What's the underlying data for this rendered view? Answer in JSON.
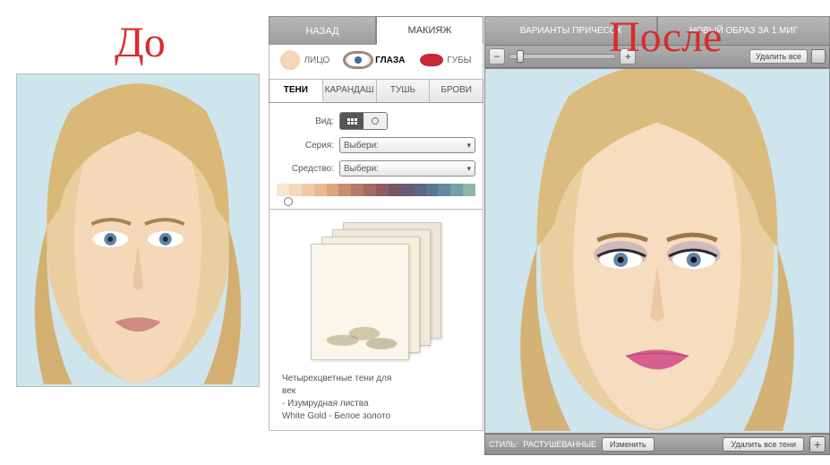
{
  "labels": {
    "before": "До",
    "after": "После"
  },
  "top_tabs": {
    "back": "НАЗАД",
    "makeup": "МАКИЯЖ",
    "hairstyles": "ВАРИАНТЫ ПРИЧЕСОК",
    "new_look": "НОВЫЙ ОБРАЗ ЗА 1 МИГ"
  },
  "face_tabs": {
    "face": "ЛИЦО",
    "eyes": "ГЛАЗА",
    "lips": "ГУБЫ"
  },
  "category_tabs": {
    "shadows": "ТЕНИ",
    "pencil": "КАРАНДАШ",
    "mascara": "ТУШЬ",
    "brows": "БРОВИ"
  },
  "options": {
    "view_label": "Вид:",
    "series_label": "Серия:",
    "product_label": "Средство:",
    "select_placeholder": "Выбери:"
  },
  "palette_colors": [
    "#f7e6d2",
    "#f3d9bd",
    "#eecba7",
    "#e7bb93",
    "#dba57d",
    "#c88e6e",
    "#b77c68",
    "#a36b63",
    "#8e5d60",
    "#7a5562",
    "#6a5a72",
    "#5f6584",
    "#5b7596",
    "#6189a2",
    "#74a1a7",
    "#8fb7a5"
  ],
  "swatch": {
    "line1": "Четырехцветные тени для",
    "line2": "век",
    "line3": "- Изумрудная листва",
    "line4": "White Gold - Белое золото"
  },
  "right_toolbar": {
    "delete_all": "Удалить все"
  },
  "right_bottom": {
    "style_label": "СТИЛЬ:",
    "style_value": "РАСТУШЕВАННЫЕ",
    "change": "Изменить",
    "delete_all_shadows": "Удалить все тени"
  }
}
